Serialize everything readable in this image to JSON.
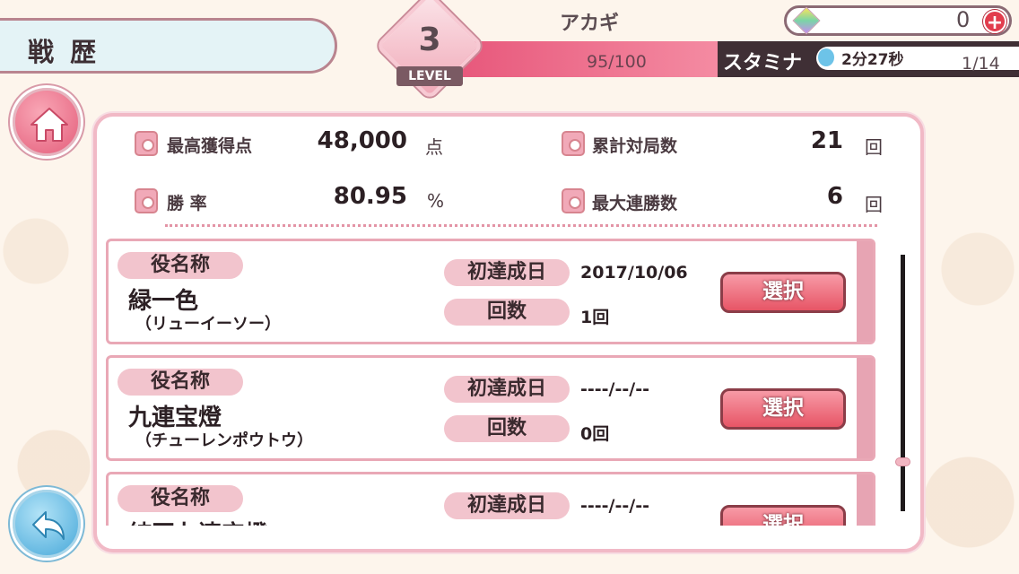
{
  "header": {
    "title": "戦 歴",
    "level": "3",
    "level_label": "LEVEL",
    "player_name": "アカギ",
    "exp": "95/100",
    "stamina_label": "スタミナ",
    "stamina_timer": "2分27秒",
    "stamina_count": "1/14",
    "gem_count": "0",
    "add_label": "+"
  },
  "stats": {
    "high_score_label": "最高獲得点",
    "high_score_value": "48,000",
    "high_score_unit": "点",
    "total_games_label": "累計対局数",
    "total_games_value": "21",
    "total_games_unit": "回",
    "win_rate_label": "勝 率",
    "win_rate_value": "80.95",
    "win_rate_unit": "%",
    "max_streak_label": "最大連勝数",
    "max_streak_value": "6",
    "max_streak_unit": "回"
  },
  "labels": {
    "yaku_name": "役名称",
    "first_date": "初達成日",
    "count": "回数",
    "select": "選択"
  },
  "yaku": [
    {
      "name": "緑一色",
      "reading": "（リューイーソー）",
      "date": "2017/10/06",
      "count": "1回"
    },
    {
      "name": "九連宝燈",
      "reading": "（チューレンポウトウ）",
      "date": "----/--/--",
      "count": "0回"
    },
    {
      "name": "純正九連宝燈",
      "reading": "",
      "date": "----/--/--",
      "count": ""
    }
  ],
  "colors": {
    "accent": "#e75566",
    "panel_border": "#f1b9c6",
    "pill": "#f2c4cd"
  }
}
